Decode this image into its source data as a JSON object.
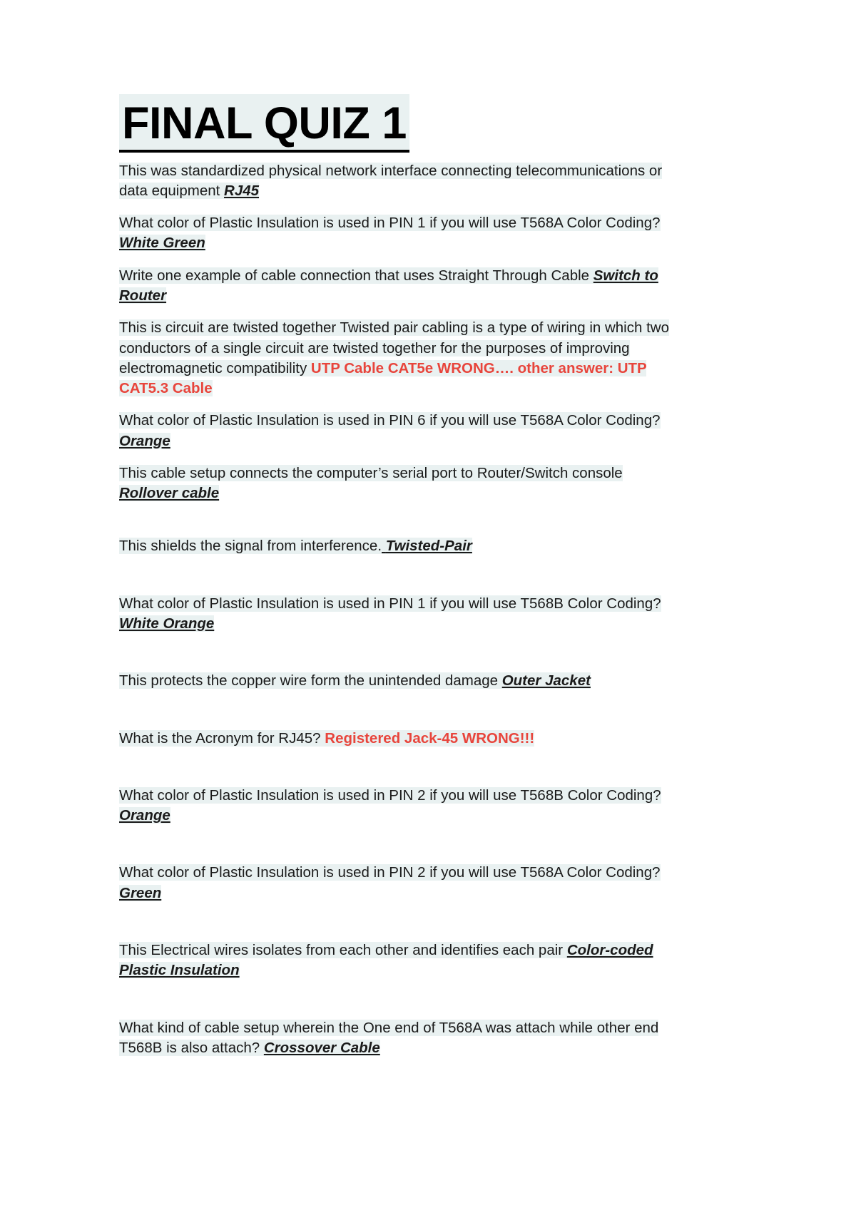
{
  "document": {
    "title": "FINAL QUIZ 1",
    "highlight_color": "#e9f1f1",
    "red_color": "#e8453c",
    "text_color": "#1a1a1a",
    "items": [
      {
        "id": "q1",
        "question": "This was standardized physical network interface connecting telecommunications or data equipment ",
        "answer": "RJ45",
        "answer_style": "bold-italic-underline"
      },
      {
        "id": "q2",
        "question": "What color of Plastic Insulation is used in PIN 1 if you will use T568A Color Coding? ",
        "answer": "White Green",
        "answer_style": "bold-italic-underline"
      },
      {
        "id": "q3",
        "question": "Write one example of cable connection that uses Straight Through Cable ",
        "answer": "Switch to Router",
        "answer_style": "bold-italic-underline"
      },
      {
        "id": "q4",
        "question": "This is circuit are twisted together Twisted pair cabling is a type of wiring in which two conductors of a single circuit are twisted together for the purposes of improving electromagnetic compatibility ",
        "answer": "UTP Cable CAT5e WRONG…. other answer: UTP CAT5.3 Cable",
        "answer_style": "red-bold"
      },
      {
        "id": "q5",
        "question": "What color of Plastic Insulation is used in PIN 6 if you will use T568A Color Coding? ",
        "answer": "Orange",
        "answer_style": "bold-italic-underline"
      },
      {
        "id": "q6",
        "question": "This cable setup connects the computer’s serial port to Router/Switch console ",
        "answer": "Rollover cable",
        "answer_style": "bold-italic-underline"
      },
      {
        "id": "q7",
        "question": "This shields the signal from interference.",
        "answer": "Twisted-Pair",
        "answer_style": "bold-italic-underline"
      },
      {
        "id": "q8",
        "question": "What color of Plastic Insulation is used in PIN 1 if you will use T568B Color Coding? ",
        "answer": "White Orange",
        "answer_style": "bold-italic-underline"
      },
      {
        "id": "q9",
        "question": "This protects the copper wire form the unintended damage ",
        "answer": "Outer Jacket",
        "answer_style": "bold-italic-underline"
      },
      {
        "id": "q10",
        "question": "What is the Acronym for RJ45? ",
        "answer": "Registered Jack-45 WRONG!!!",
        "answer_style": "red-bold"
      },
      {
        "id": "q11",
        "question": "What color of Plastic Insulation is used in PIN 2 if you will use T568B Color Coding? ",
        "answer": "Orange",
        "answer_style": "bold-italic-underline"
      },
      {
        "id": "q12",
        "question": "What color of Plastic Insulation is used in PIN 2 if you will use T568A Color Coding? ",
        "answer": "Green",
        "answer_style": "bold-italic-underline"
      },
      {
        "id": "q13",
        "question": "This Electrical wires isolates from each other and identifies each pair ",
        "answer": "Color-coded Plastic Insulation",
        "answer_style": "bold-italic-underline"
      },
      {
        "id": "q14",
        "question": "What kind of cable setup wherein the One end of T568A was attach while other end T568B is also attach? ",
        "answer": "Crossover Cable",
        "answer_style": "bold-italic-underline"
      }
    ]
  }
}
